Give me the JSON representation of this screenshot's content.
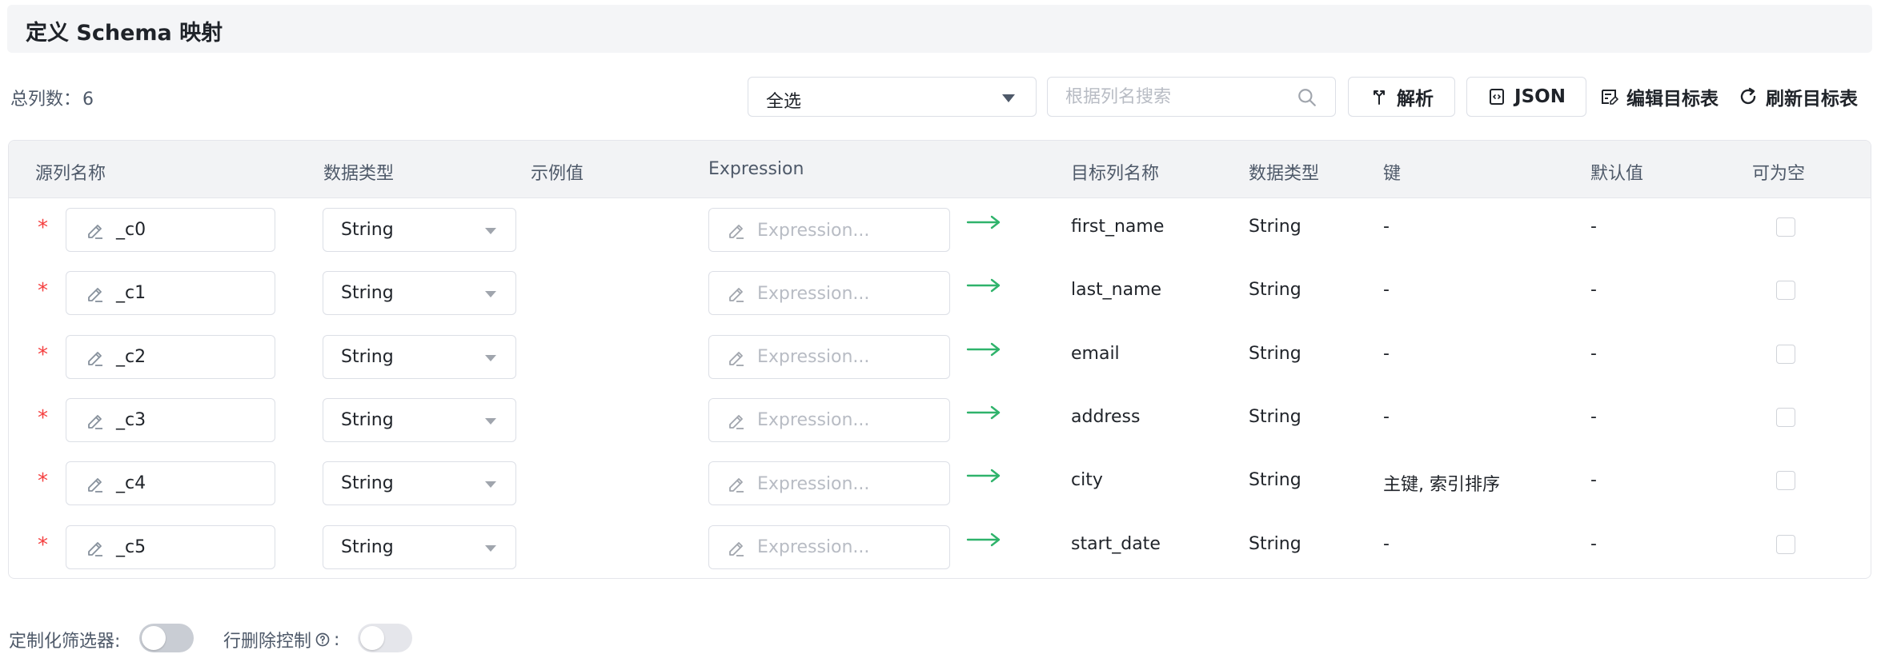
{
  "header": {
    "title": "定义 Schema 映射"
  },
  "toolbar": {
    "total_label": "总列数：",
    "total_count": "6",
    "select_value": "全选",
    "search_placeholder": "根据列名搜索",
    "parse_label": "解析",
    "json_label": "JSON",
    "edit_target_label": "编辑目标表",
    "refresh_target_label": "刷新目标表"
  },
  "table": {
    "columns": {
      "source_name": "源列名称",
      "data_type": "数据类型",
      "sample": "示例值",
      "expression": "Expression",
      "target_name": "目标列名称",
      "target_type": "数据类型",
      "key": "键",
      "default": "默认值",
      "nullable": "可为空"
    },
    "expression_placeholder": "Expression...",
    "rows": [
      {
        "required": "*",
        "source": "_c0",
        "type": "String",
        "sample": "",
        "target": "first_name",
        "target_type": "String",
        "key": "-",
        "default": "-",
        "nullable": false
      },
      {
        "required": "*",
        "source": "_c1",
        "type": "String",
        "sample": "",
        "target": "last_name",
        "target_type": "String",
        "key": "-",
        "default": "-",
        "nullable": false
      },
      {
        "required": "*",
        "source": "_c2",
        "type": "String",
        "sample": "",
        "target": "email",
        "target_type": "String",
        "key": "-",
        "default": "-",
        "nullable": false
      },
      {
        "required": "*",
        "source": "_c3",
        "type": "String",
        "sample": "",
        "target": "address",
        "target_type": "String",
        "key": "-",
        "default": "-",
        "nullable": false
      },
      {
        "required": "*",
        "source": "_c4",
        "type": "String",
        "sample": "",
        "target": "city",
        "target_type": "String",
        "key": "主键, 索引排序",
        "default": "-",
        "nullable": false
      },
      {
        "required": "*",
        "source": "_c5",
        "type": "String",
        "sample": "",
        "target": "start_date",
        "target_type": "String",
        "key": "-",
        "default": "-",
        "nullable": false
      }
    ]
  },
  "footer": {
    "custom_filter_label": "定制化筛选器:",
    "custom_filter_on": false,
    "row_delete_label": "行删除控制",
    "row_delete_suffix": ":",
    "row_delete_on": false
  },
  "colors": {
    "required": "#f53f3f",
    "arrow": "#2fb36b",
    "header_bg": "#f4f5f7"
  }
}
